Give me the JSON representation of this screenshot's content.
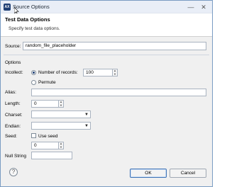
{
  "window": {
    "title": "Source Options",
    "app_icon_text": "AX"
  },
  "header": {
    "title": "Test Data Options",
    "subtitle": "Specify test data options."
  },
  "source": {
    "label": "Source:",
    "value": "random_file_placeholder"
  },
  "options": {
    "section_label": "Options",
    "incollect_label": "Incollect:",
    "number_of_records_label": "Number of records:",
    "number_of_records_value": "100",
    "permute_label": "Permute",
    "alias_label": "Alias:",
    "alias_value": "",
    "length_label": "Length:",
    "length_value": "0",
    "charset_label": "Charset:",
    "charset_value": "",
    "endian_label": "Endian:",
    "endian_value": "",
    "seed_label": "Seed:",
    "use_seed_label": "Use seed",
    "seed_value": "0",
    "null_string_label": "Null String",
    "null_string_value": ""
  },
  "footer": {
    "help_glyph": "?",
    "ok_label": "OK",
    "cancel_label": "Cancel"
  }
}
